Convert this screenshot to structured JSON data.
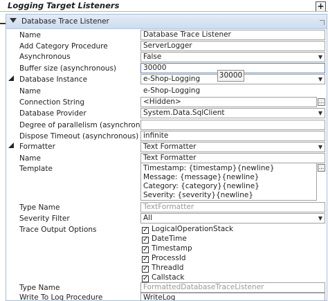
{
  "header": {
    "title": "Logging Target Listeners",
    "add_label": "+"
  },
  "listener": {
    "title": "Database Trace Listener",
    "rows": [
      {
        "label": "Name",
        "value": "Database Trace Listener"
      },
      {
        "label": "Add Category Procedure",
        "value": "ServerLogger"
      },
      {
        "label": "Asynchronous",
        "value": "False"
      },
      {
        "label": "Buffer size (asynchronous)",
        "value": "30000"
      },
      {
        "label": "Database Instance",
        "value": "e-Shop-Logging"
      },
      {
        "label": "Name",
        "value": "e-Shop-Logging"
      },
      {
        "label": "Connection String",
        "value": "<Hidden>"
      },
      {
        "label": "Database Provider",
        "value": "System.Data.SqlClient"
      },
      {
        "label": "Degree of parallelism (asynchronous)",
        "value": ""
      },
      {
        "label": "Dispose Timeout (asynchronous)",
        "value": "infinite"
      },
      {
        "label": "Formatter",
        "value": "Text Formatter"
      },
      {
        "label": "Name",
        "value": "Text Formatter"
      },
      {
        "label": "Template",
        "value": ""
      },
      {
        "label": "Type Name",
        "value": "TextFormatter"
      },
      {
        "label": "Severity Filter",
        "value": "All"
      },
      {
        "label": "Trace Output Options",
        "value": ""
      },
      {
        "label": "Type Name",
        "value": "FormattedDatabaseTraceListener"
      },
      {
        "label": "Write To Log Procedure",
        "value": "WriteLog"
      }
    ],
    "template_lines": [
      "Timestamp: {timestamp}{newline}",
      "Message: {message}{newline}",
      "Category: {category}{newline}",
      "Severity: {severity}{newline}"
    ],
    "trace_options": [
      {
        "label": "LogicalOperationStack",
        "checked": true
      },
      {
        "label": "DateTime",
        "checked": true
      },
      {
        "label": "Timestamp",
        "checked": true
      },
      {
        "label": "ProcessId",
        "checked": true
      },
      {
        "label": "ThreadId",
        "checked": true
      },
      {
        "label": "Callstack",
        "checked": true
      }
    ],
    "tooltip": "30000",
    "ellipsis": "..."
  }
}
